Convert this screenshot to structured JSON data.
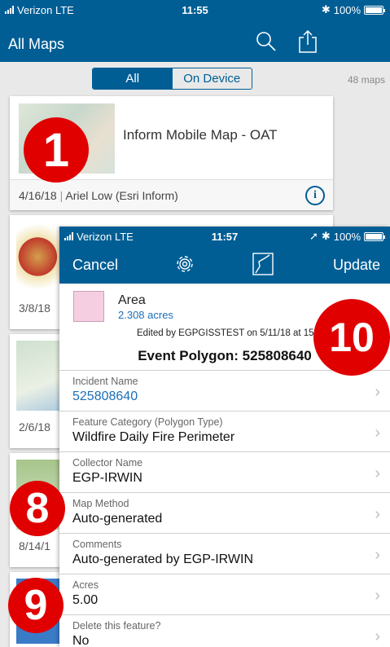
{
  "back": {
    "status": {
      "carrier": "Verizon  LTE",
      "time": "11:55",
      "battery": "100%"
    },
    "nav": {
      "title": "All Maps"
    },
    "segment": {
      "all": "All",
      "on_device": "On Device"
    },
    "count": "48 maps",
    "card1": {
      "name": "Inform Mobile Map - OAT",
      "date": "4/16/18",
      "author": "Ariel Low (Esri Inform)",
      "info": "i"
    },
    "dates": [
      "3/8/18",
      "2/6/18",
      "8/14/1"
    ]
  },
  "front": {
    "status": {
      "carrier": "Verizon  LTE",
      "time": "11:57",
      "battery": "100%"
    },
    "nav": {
      "cancel": "Cancel",
      "update": "Update"
    },
    "area_label": "Area",
    "acres_value": "2.308 acres",
    "edited": "Edited by EGPGISSTEST on 5/11/18 at 15",
    "title": "Event Polygon: 525808640",
    "fields": [
      {
        "label": "Incident Name",
        "value": "525808640"
      },
      {
        "label": "Feature Category (Polygon Type)",
        "value": "Wildfire Daily Fire Perimeter"
      },
      {
        "label": "Collector Name",
        "value": "EGP-IRWIN"
      },
      {
        "label": "Map Method",
        "value": "Auto-generated"
      },
      {
        "label": "Comments",
        "value": "Auto-generated by EGP-IRWIN"
      },
      {
        "label": "Acres",
        "value": "5.00"
      },
      {
        "label": "Delete this feature?",
        "value": "No"
      }
    ],
    "chevron": "›"
  },
  "badges": {
    "one": "1",
    "ten": "10",
    "eight": "8",
    "nine": "9"
  },
  "colors": {
    "nav_blue": "#005e95",
    "link_blue": "#1c6fb8",
    "badge_red": "#e00000"
  }
}
